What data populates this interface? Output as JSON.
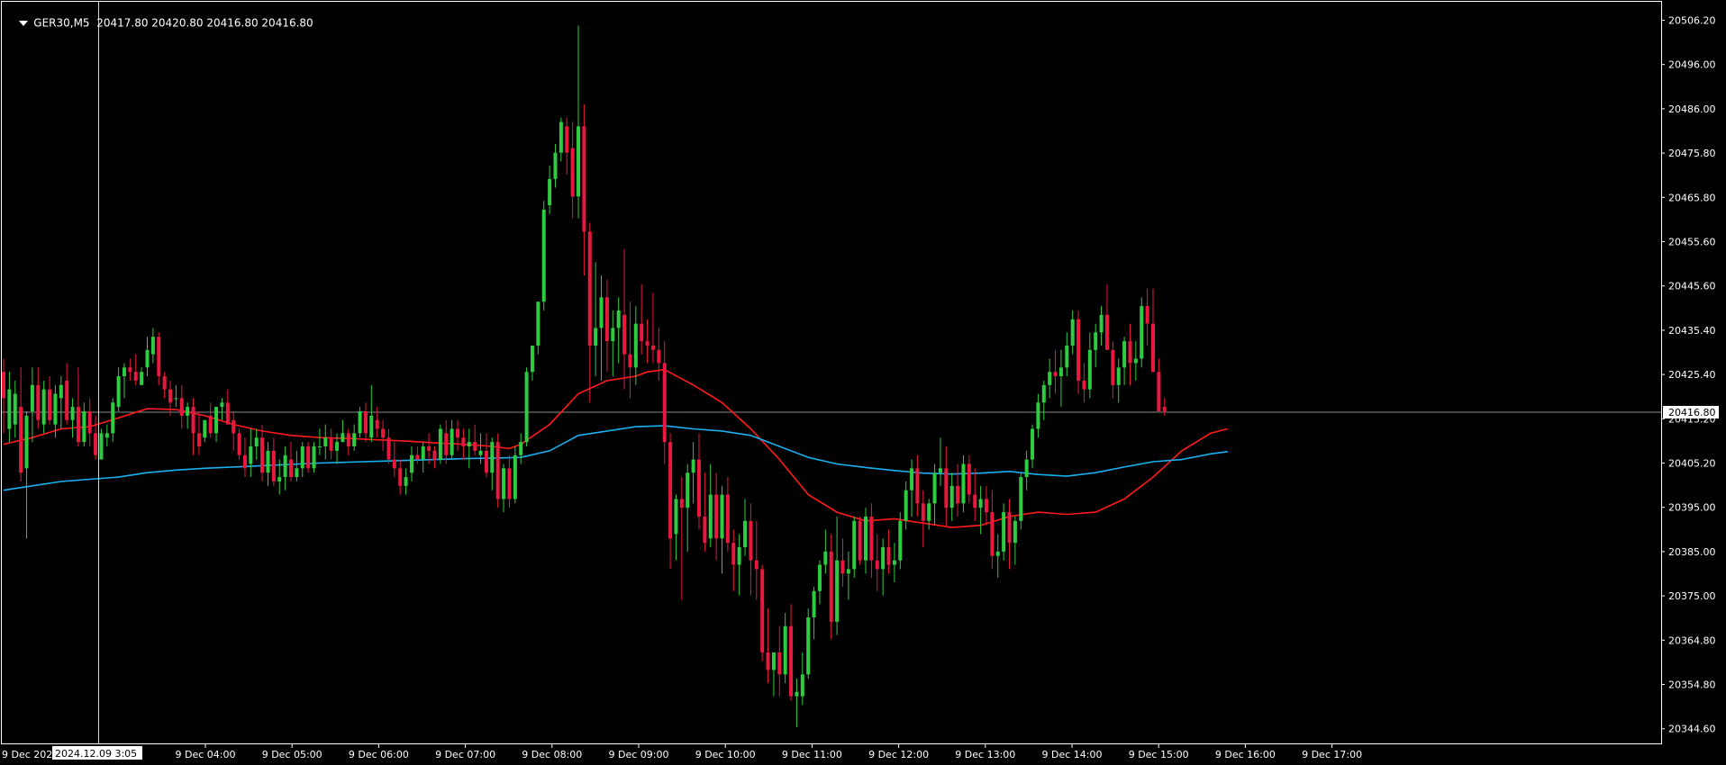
{
  "header": {
    "symbol": "GER30,M5",
    "ohlc": "20417.80 20420.80 20416.80 20416.80"
  },
  "crosshair": {
    "date_label": "2024.12.09 3:05",
    "truncated_left_label": "9 Dec 202"
  },
  "colors": {
    "background": "#000000",
    "axis": "#ffffff",
    "bull": "#2ecc40",
    "bear": "#e8183f",
    "ma_fast": "#ff1a1a",
    "ma_slow": "#1ab0f0",
    "bid_line": "#8a8a8a"
  },
  "chart_data": {
    "type": "candlestick",
    "timeframe": "M5",
    "symbol": "GER30",
    "y_ticks": [
      "20506.20",
      "20496.00",
      "20486.00",
      "20475.80",
      "20465.80",
      "20455.60",
      "20445.60",
      "20435.40",
      "20425.40",
      "20415.20",
      "20405.20",
      "20395.00",
      "20385.00",
      "20375.00",
      "20364.80",
      "20354.80",
      "20344.60"
    ],
    "x_ticks": [
      "9 Dec 04:00",
      "9 Dec 05:00",
      "9 Dec 06:00",
      "9 Dec 07:00",
      "9 Dec 08:00",
      "9 Dec 09:00",
      "9 Dec 10:00",
      "9 Dec 11:00",
      "9 Dec 12:00",
      "9 Dec 13:00",
      "9 Dec 14:00",
      "9 Dec 15:00",
      "9 Dec 16:00",
      "9 Dec 17:00"
    ],
    "ylim": [
      20340.6,
      20510.5
    ],
    "current_price": "20416.80",
    "candles": [
      [
        20426,
        20429,
        20412,
        20420
      ],
      [
        20413,
        20426,
        20410,
        20422
      ],
      [
        20414,
        20424,
        20411,
        20421
      ],
      [
        20418,
        20427,
        20401,
        20403
      ],
      [
        20404,
        20417,
        20388,
        20416
      ],
      [
        20417,
        20427,
        20410,
        20423
      ],
      [
        20423,
        20427,
        20413,
        20415
      ],
      [
        20414,
        20424,
        20412,
        20422
      ],
      [
        20422,
        20425,
        20414,
        20415
      ],
      [
        20414,
        20423,
        20411,
        20421
      ],
      [
        20420,
        20425,
        20413,
        20423
      ],
      [
        20424,
        20428,
        20414,
        20415
      ],
      [
        20415,
        20420,
        20411,
        20418
      ],
      [
        20418,
        20427,
        20409,
        20410
      ],
      [
        20410,
        20419,
        20409,
        20417
      ],
      [
        20417,
        20420,
        20409,
        20412
      ],
      [
        20412,
        20416,
        20406,
        20407
      ],
      [
        20406,
        20413,
        20406,
        20412
      ],
      [
        20411,
        20414,
        20409,
        20412
      ],
      [
        20412,
        20420,
        20410,
        20419
      ],
      [
        20418,
        20427,
        20417,
        20425
      ],
      [
        20425,
        20428,
        20420,
        20427
      ],
      [
        20427,
        20429,
        20424,
        20426
      ],
      [
        20426,
        20430,
        20423,
        20424
      ],
      [
        20423,
        20427,
        20423,
        20426
      ],
      [
        20427,
        20434,
        20425,
        20431
      ],
      [
        20430,
        20436,
        20428,
        20434
      ],
      [
        20434,
        20435,
        20423,
        20425
      ],
      [
        20425,
        20426,
        20420,
        20422
      ],
      [
        20422,
        20424,
        20416,
        20419
      ],
      [
        20420,
        20423,
        20418,
        20420
      ],
      [
        20420,
        20423,
        20413,
        20416
      ],
      [
        20416,
        20419,
        20413,
        20418
      ],
      [
        20418,
        20420,
        20407,
        20412
      ],
      [
        20412,
        20417,
        20407,
        20409
      ],
      [
        20411,
        20415,
        20410,
        20415
      ],
      [
        20416,
        20419,
        20411,
        20412
      ],
      [
        20412,
        20418,
        20410,
        20418
      ],
      [
        20418,
        20420,
        20415,
        20419
      ],
      [
        20419,
        20422,
        20414,
        20414
      ],
      [
        20415,
        20417,
        20408,
        20412
      ],
      [
        20412,
        20413,
        20406,
        20407
      ],
      [
        20407,
        20411,
        20402,
        20404
      ],
      [
        20405,
        20413,
        20402,
        20409
      ],
      [
        20409,
        20413,
        20406,
        20411
      ],
      [
        20411,
        20414,
        20401,
        20403
      ],
      [
        20403,
        20410,
        20400,
        20408
      ],
      [
        20408,
        20411,
        20400,
        20401
      ],
      [
        20401,
        20406,
        20398,
        20402
      ],
      [
        20402,
        20409,
        20399,
        20407
      ],
      [
        20406,
        20410,
        20401,
        20402
      ],
      [
        20402,
        20408,
        20401,
        20404
      ],
      [
        20404,
        20410,
        20402,
        20409
      ],
      [
        20409,
        20410,
        20403,
        20404
      ],
      [
        20404,
        20410,
        20403,
        20409
      ],
      [
        20409,
        20413,
        20407,
        20409
      ],
      [
        20409,
        20414,
        20406,
        20411
      ],
      [
        20411,
        20413,
        20406,
        20408
      ],
      [
        20408,
        20412,
        20405,
        20410
      ],
      [
        20410,
        20415,
        20410,
        20412
      ],
      [
        20412,
        20413,
        20407,
        20409
      ],
      [
        20409,
        20414,
        20408,
        20412
      ],
      [
        20412,
        20418,
        20411,
        20417
      ],
      [
        20417,
        20419,
        20410,
        20412
      ],
      [
        20411,
        20423,
        20410,
        20416
      ],
      [
        20415,
        20418,
        20411,
        20413
      ],
      [
        20413,
        20415,
        20408,
        20411
      ],
      [
        20411,
        20413,
        20405,
        20406
      ],
      [
        20406,
        20410,
        20402,
        20404
      ],
      [
        20404,
        20406,
        20398,
        20400
      ],
      [
        20400,
        20404,
        20398,
        20402
      ],
      [
        20403,
        20409,
        20401,
        20407
      ],
      [
        20407,
        20409,
        20405,
        20406
      ],
      [
        20406,
        20410,
        20403,
        20409
      ],
      [
        20409,
        20412,
        20405,
        20408
      ],
      [
        20408,
        20409,
        20404,
        20406
      ],
      [
        20406,
        20414,
        20405,
        20413
      ],
      [
        20412,
        20415,
        20405,
        20407
      ],
      [
        20407,
        20415,
        20406,
        20413
      ],
      [
        20413,
        20415,
        20408,
        20411
      ],
      [
        20411,
        20413,
        20406,
        20409
      ],
      [
        20409,
        20413,
        20404,
        20410
      ],
      [
        20410,
        20414,
        20407,
        20408
      ],
      [
        20407,
        20412,
        20405,
        20408
      ],
      [
        20408,
        20412,
        20402,
        20403
      ],
      [
        20403,
        20411,
        20399,
        20410
      ],
      [
        20410,
        20412,
        20395,
        20397
      ],
      [
        20397,
        20405,
        20394,
        20404
      ],
      [
        20404,
        20407,
        20395,
        20397
      ],
      [
        20397,
        20409,
        20396,
        20407
      ],
      [
        20407,
        20412,
        20405,
        20410
      ],
      [
        20410,
        20427,
        20409,
        20426
      ],
      [
        20426,
        20432,
        20424,
        20432
      ],
      [
        20432,
        20442,
        20430,
        20442
      ],
      [
        20442,
        20465,
        20440,
        20463
      ],
      [
        20464,
        20473,
        20462,
        20470
      ],
      [
        20470,
        20478,
        20468,
        20476
      ],
      [
        20476,
        20484,
        20474,
        20483
      ],
      [
        20482,
        20484,
        20471,
        20476
      ],
      [
        20477,
        20483,
        20461,
        20466
      ],
      [
        20466,
        20505,
        20461,
        20482
      ],
      [
        20482,
        20487,
        20448,
        20458
      ],
      [
        20458,
        20460,
        20419,
        20432
      ],
      [
        20432,
        20451,
        20425,
        20436
      ],
      [
        20436,
        20448,
        20424,
        20443
      ],
      [
        20443,
        20447,
        20426,
        20433
      ],
      [
        20433,
        20440,
        20425,
        20436
      ],
      [
        20436,
        20443,
        20428,
        20440
      ],
      [
        20439,
        20454,
        20422,
        20430
      ],
      [
        20430,
        20442,
        20420,
        20427
      ],
      [
        20427,
        20441,
        20423,
        20437
      ],
      [
        20437,
        20446,
        20430,
        20433
      ],
      [
        20433,
        20438,
        20428,
        20432
      ],
      [
        20432,
        20444,
        20428,
        20431
      ],
      [
        20431,
        20436,
        20424,
        20428
      ],
      [
        20428,
        20433,
        20405,
        20410
      ],
      [
        20410,
        20412,
        20381,
        20388
      ],
      [
        20389,
        20398,
        20383,
        20397
      ],
      [
        20397,
        20402,
        20374,
        20395
      ],
      [
        20395,
        20405,
        20385,
        20403
      ],
      [
        20403,
        20410,
        20396,
        20406
      ],
      [
        20406,
        20412,
        20390,
        20393
      ],
      [
        20393,
        20403,
        20385,
        20387
      ],
      [
        20388,
        20405,
        20386,
        20398
      ],
      [
        20398,
        20403,
        20383,
        20388
      ],
      [
        20388,
        20400,
        20380,
        20398
      ],
      [
        20398,
        20402,
        20385,
        20387
      ],
      [
        20387,
        20390,
        20376,
        20382
      ],
      [
        20382,
        20389,
        20375,
        20386
      ],
      [
        20386,
        20397,
        20384,
        20392
      ],
      [
        20392,
        20396,
        20375,
        20383
      ],
      [
        20383,
        20392,
        20374,
        20381
      ],
      [
        20381,
        20382,
        20360,
        20362
      ],
      [
        20362,
        20372,
        20355,
        20358
      ],
      [
        20358,
        20362,
        20352,
        20362
      ],
      [
        20362,
        20368,
        20352,
        20357
      ],
      [
        20357,
        20371,
        20355,
        20368
      ],
      [
        20368,
        20373,
        20351,
        20352
      ],
      [
        20352,
        20356,
        20345,
        20353
      ],
      [
        20352,
        20362,
        20350,
        20357
      ],
      [
        20357,
        20372,
        20356,
        20370
      ],
      [
        20370,
        20377,
        20365,
        20376
      ],
      [
        20376,
        20383,
        20373,
        20382
      ],
      [
        20382,
        20390,
        20380,
        20385
      ],
      [
        20385,
        20389,
        20365,
        20369
      ],
      [
        20369,
        20393,
        20366,
        20383
      ],
      [
        20383,
        20388,
        20377,
        20380
      ],
      [
        20380,
        20385,
        20374,
        20381
      ],
      [
        20381,
        20393,
        20379,
        20392
      ],
      [
        20392,
        20393,
        20382,
        20383
      ],
      [
        20383,
        20395,
        20380,
        20393
      ],
      [
        20393,
        20396,
        20379,
        20383
      ],
      [
        20383,
        20389,
        20376,
        20381
      ],
      [
        20381,
        20388,
        20375,
        20386
      ],
      [
        20386,
        20390,
        20380,
        20382
      ],
      [
        20382,
        20387,
        20378,
        20383
      ],
      [
        20383,
        20394,
        20381,
        20392
      ],
      [
        20392,
        20401,
        20390,
        20399
      ],
      [
        20399,
        20406,
        20393,
        20404
      ],
      [
        20404,
        20407,
        20393,
        20396
      ],
      [
        20396,
        20399,
        20386,
        20392
      ],
      [
        20392,
        20397,
        20390,
        20396
      ],
      [
        20396,
        20405,
        20391,
        20403
      ],
      [
        20403,
        20411,
        20400,
        20404
      ],
      [
        20404,
        20409,
        20391,
        20395
      ],
      [
        20395,
        20403,
        20392,
        20400
      ],
      [
        20400,
        20405,
        20393,
        20396
      ],
      [
        20396,
        20407,
        20394,
        20405
      ],
      [
        20405,
        20407,
        20396,
        20398
      ],
      [
        20398,
        20404,
        20392,
        20395
      ],
      [
        20395,
        20400,
        20389,
        20397
      ],
      [
        20397,
        20400,
        20391,
        20394
      ],
      [
        20394,
        20399,
        20381,
        20384
      ],
      [
        20384,
        20389,
        20379,
        20385
      ],
      [
        20385,
        20396,
        20383,
        20394
      ],
      [
        20394,
        20397,
        20381,
        20387
      ],
      [
        20387,
        20393,
        20382,
        20392
      ],
      [
        20392,
        20403,
        20390,
        20402
      ],
      [
        20402,
        20408,
        20399,
        20406
      ],
      [
        20406,
        20414,
        20404,
        20413
      ],
      [
        20413,
        20421,
        20411,
        20419
      ],
      [
        20419,
        20424,
        20415,
        20423
      ],
      [
        20423,
        20429,
        20420,
        20426
      ],
      [
        20426,
        20431,
        20421,
        20425
      ],
      [
        20425,
        20431,
        20418,
        20427
      ],
      [
        20427,
        20435,
        20425,
        20432
      ],
      [
        20432,
        20440,
        20430,
        20438
      ],
      [
        20438,
        20440,
        20421,
        20424
      ],
      [
        20424,
        20428,
        20419,
        20422
      ],
      [
        20422,
        20435,
        20420,
        20431
      ],
      [
        20431,
        20437,
        20427,
        20435
      ],
      [
        20435,
        20441,
        20432,
        20439
      ],
      [
        20439,
        20446,
        20434,
        20431
      ],
      [
        20431,
        20433,
        20420,
        20423
      ],
      [
        20423,
        20429,
        20419,
        20427
      ],
      [
        20427,
        20434,
        20423,
        20433
      ],
      [
        20433,
        20437,
        20423,
        20428
      ],
      [
        20428,
        20433,
        20424,
        20429
      ],
      [
        20429,
        20443,
        20427,
        20441
      ],
      [
        20441,
        20445,
        20432,
        20437
      ],
      [
        20437,
        20445,
        20426,
        20426
      ],
      [
        20426,
        20429,
        20417,
        20417
      ],
      [
        20418,
        20420,
        20416,
        20417
      ]
    ],
    "series": [
      {
        "color": "#ff1a1a",
        "x": [
          0,
          5,
          10,
          15,
          20,
          25,
          30,
          35,
          40,
          45,
          50,
          55,
          60,
          65,
          70,
          75,
          80,
          85,
          88,
          90,
          95,
          100,
          105,
          110,
          112,
          115,
          120,
          125,
          130,
          135,
          140,
          145,
          150,
          155,
          160,
          165,
          170,
          175,
          180,
          185,
          190,
          195,
          200,
          205,
          210,
          213
        ],
        "values": [
          20409.5,
          20411,
          20413,
          20413.5,
          20415.5,
          20417.6,
          20417.4,
          20416,
          20414,
          20412.5,
          20411.5,
          20411,
          20410.8,
          20410.5,
          20410.2,
          20409.8,
          20409.5,
          20409,
          20408.5,
          20409.5,
          20414,
          20421,
          20424,
          20425,
          20426,
          20426.5,
          20423,
          20419,
          20413,
          20406,
          20398,
          20394,
          20392,
          20392.5,
          20391.5,
          20390.5,
          20391,
          20393,
          20394,
          20393.5,
          20394,
          20397,
          20402,
          20408,
          20412,
          20413
        ]
      },
      {
        "color": "#1ab0f0",
        "x": [
          0,
          5,
          10,
          15,
          20,
          25,
          30,
          35,
          40,
          45,
          50,
          55,
          60,
          65,
          70,
          75,
          80,
          85,
          90,
          95,
          100,
          105,
          110,
          115,
          120,
          125,
          130,
          135,
          140,
          145,
          150,
          155,
          160,
          165,
          170,
          175,
          180,
          185,
          190,
          195,
          200,
          205,
          210,
          213
        ],
        "values": [
          20399,
          20400,
          20401,
          20401.5,
          20402,
          20403,
          20403.6,
          20404,
          20404.3,
          20404.6,
          20404.9,
          20405.2,
          20405.4,
          20405.6,
          20405.8,
          20406,
          20406.2,
          20406.3,
          20406.5,
          20408,
          20411.5,
          20412.5,
          20413.5,
          20413.7,
          20413,
          20412.5,
          20411.5,
          20409,
          20406.5,
          20405,
          20404.2,
          20403.5,
          20402.9,
          20402.7,
          20402.9,
          20403.3,
          20402.6,
          20402.2,
          20403,
          20404.3,
          20405.5,
          20406,
          20407.3,
          20407.8
        ]
      }
    ]
  }
}
